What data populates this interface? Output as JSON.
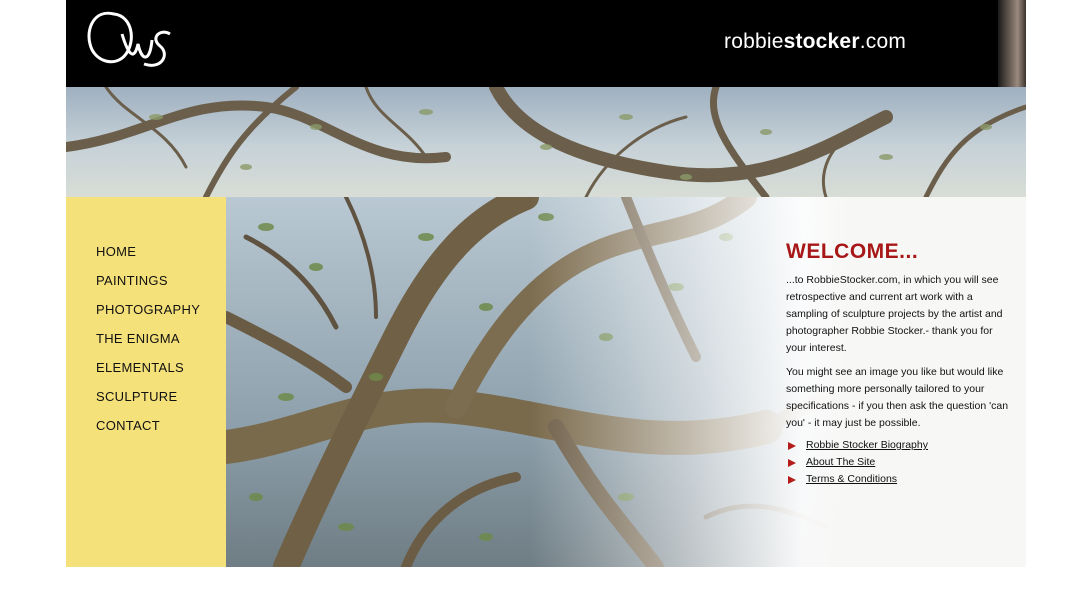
{
  "header": {
    "logo_alt": "RWS monogram",
    "title_prefix": "robbie",
    "title_bold": "stocker",
    "title_suffix": ".com"
  },
  "nav": {
    "items": [
      {
        "label": "HOME"
      },
      {
        "label": "PAINTINGS"
      },
      {
        "label": "PHOTOGRAPHY"
      },
      {
        "label": "THE ENIGMA"
      },
      {
        "label": "ELEMENTALS"
      },
      {
        "label": "SCULPTURE"
      },
      {
        "label": "CONTACT"
      }
    ]
  },
  "welcome": {
    "heading": "WELCOME...",
    "para1": "...to RobbieStocker.com, in which you will see retrospective and current art work with a sampling of sculpture projects by the artist and photographer Robbie Stocker.- thank you for your interest.",
    "para2": "You might see an image you like but would like something more personally tailored to your specifications - if you then ask the question 'can you' - it may just be possible.",
    "links": [
      {
        "label": "Robbie Stocker Biography"
      },
      {
        "label": "About The Site"
      },
      {
        "label": "Terms & Conditions"
      }
    ]
  },
  "colors": {
    "header_bg": "#000000",
    "nav_bg": "#f5e17a",
    "heading": "#a81718",
    "arrow": "#b41b1b"
  }
}
